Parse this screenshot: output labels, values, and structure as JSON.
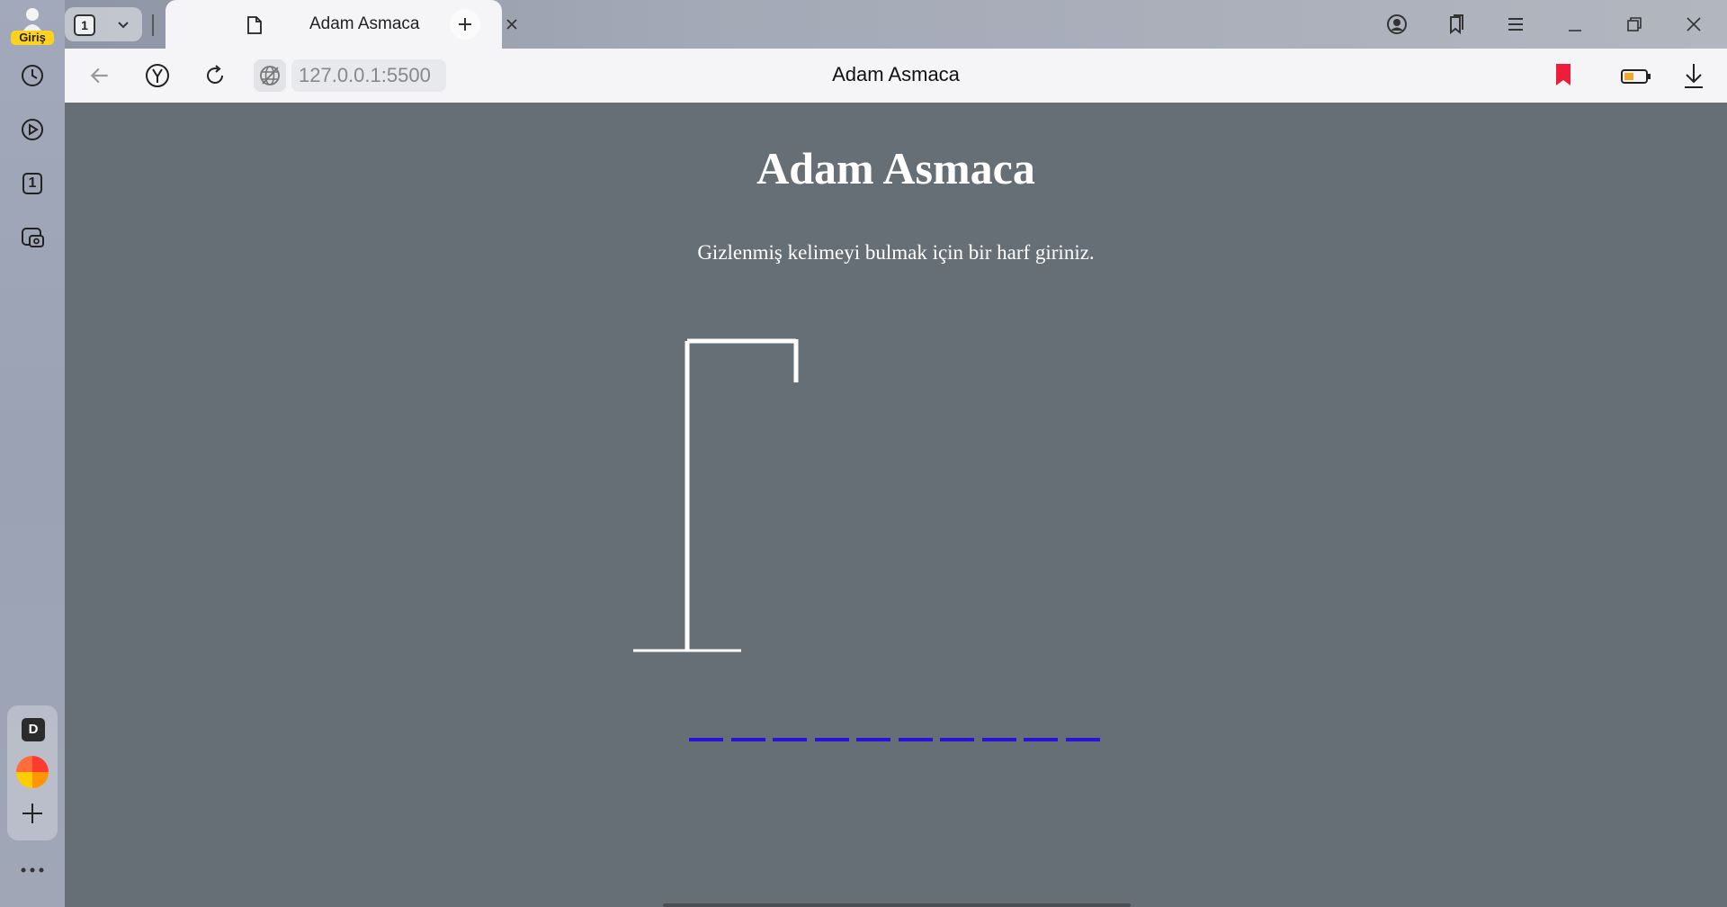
{
  "sidebar": {
    "login_label": "Giriş",
    "items": [
      {
        "name": "history-icon"
      },
      {
        "name": "play-icon"
      },
      {
        "name": "tabs-count-icon",
        "label": "1"
      },
      {
        "name": "screenshot-icon"
      }
    ],
    "bottom": {
      "d_label": "D",
      "add_icon": "plus-icon",
      "more_icon": "more-icon"
    }
  },
  "tabbar": {
    "tab_count": "1",
    "active_tab": {
      "title": "Adam Asmaca"
    }
  },
  "addressbar": {
    "url": "127.0.0.1:5500",
    "page_title": "Adam Asmaca"
  },
  "page": {
    "heading": "Adam Asmaca",
    "instruction": "Gizlenmiş kelimeyi bulmak için bir harf giriniz.",
    "word_length": 10,
    "colors": {
      "background": "#666f75",
      "text": "#ffffff",
      "blanks": "#2a13d8",
      "gallows": "#ffffff"
    }
  }
}
